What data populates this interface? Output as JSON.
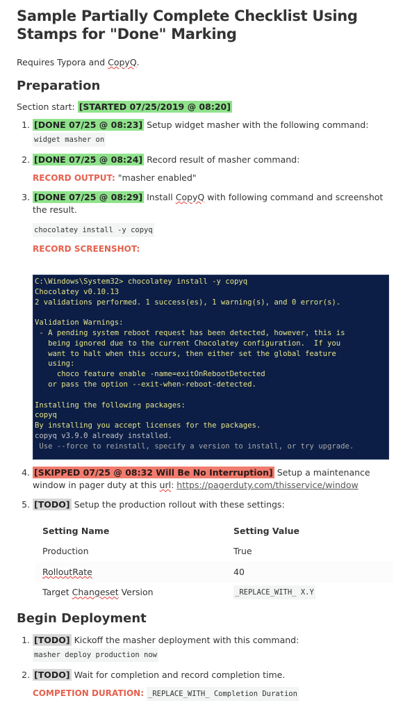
{
  "title": "Sample Partially Complete Checklist Using Stamps for \"Done\" Marking",
  "intro": {
    "before": "Requires Typora and ",
    "link": "CopyQ",
    "after": "."
  },
  "preparation": {
    "heading": "Preparation",
    "section_start_label": "Section start: ",
    "section_start_stamp": "[STARTED 07/25/2019 @ 08:20]",
    "items": [
      {
        "stamp": "[DONE 07/25 @ 08:23]",
        "text": " Setup widget masher with the following command:",
        "code": "widget masher on"
      },
      {
        "stamp": "[DONE 07/25 @ 08:24]",
        "text": " Record result of masher command:",
        "record_label": "RECORD OUTPUT:",
        "record_value": " \"masher enabled\""
      },
      {
        "stamp": "[DONE 07/25 @ 08:29]",
        "text_before": " Install ",
        "text_link": "CopyQ",
        "text_after": " with following command and screenshot the result.",
        "code": "chocolatey install -y copyq",
        "record_label": "RECORD SCREENSHOT:"
      },
      {
        "stamp": "[SKIPPED 07/25 @ 08:32 Will Be No Interruption]",
        "text_before": " Setup a maintenance window in pager duty at this ",
        "text_url_word": "url",
        "text_colon": ": ",
        "link": "https://pagerduty.com/thisservice/window"
      },
      {
        "stamp": "[TODO]",
        "text": " Setup the production rollout with these settings:"
      }
    ]
  },
  "terminal": {
    "lines": [
      {
        "text": "C:\\Windows\\System32> chocolatey install -y copyq",
        "color": "yellow"
      },
      {
        "text": "Chocolatey v0.10.13",
        "color": "yellow"
      },
      {
        "text": "2 validations performed. 1 success(es), 1 warning(s), and 0 error(s).",
        "color": "yellow"
      },
      {
        "text": "",
        "color": "gray"
      },
      {
        "text": "Validation Warnings:",
        "color": "yellow"
      },
      {
        "text": " - A pending system reboot request has been detected, however, this is",
        "color": "yellow"
      },
      {
        "text": "   being ignored due to the current Chocolatey configuration.  If you",
        "color": "yellow"
      },
      {
        "text": "   want to halt when this occurs, then either set the global feature",
        "color": "yellow"
      },
      {
        "text": "   using:",
        "color": "yellow"
      },
      {
        "text": "     choco feature enable -name=exitOnRebootDetected",
        "color": "yellow"
      },
      {
        "text": "   or pass the option --exit-when-reboot-detected.",
        "color": "yellow"
      },
      {
        "text": "",
        "color": "gray"
      },
      {
        "text": "Installing the following packages:",
        "color": "yellow"
      },
      {
        "text": "copyq",
        "color": "yellow"
      },
      {
        "text": "By installing you accept licenses for the packages.",
        "color": "yellow"
      },
      {
        "text": "copyq v3.9.0 already installed.",
        "color": "gray"
      },
      {
        "text": " Use --force to reinstall, specify a version to install, or try upgrade.",
        "color": "dim"
      }
    ]
  },
  "settings_table": {
    "headers": [
      "Setting Name",
      "Setting Value"
    ],
    "rows": [
      {
        "name": "Production",
        "value": "True"
      },
      {
        "name": "RolloutRate",
        "value": "40"
      },
      {
        "name_before": "Target ",
        "name_link": "Changeset",
        "name_after": " Version",
        "value": "_REPLACE_WITH_ X.Y"
      }
    ]
  },
  "deployment": {
    "heading": "Begin Deployment",
    "items": [
      {
        "stamp": "[TODO]",
        "text": " Kickoff the masher deployment with this command:",
        "code": "masher deploy production now"
      },
      {
        "stamp": "[TODO]",
        "text": " Wait for completion and record completion time.",
        "record_label": "COMPETION DURATION:",
        "code": "_REPLACE_WITH_ Completion Duration"
      }
    ]
  },
  "colors": {
    "stamp_done": "#8fe28b",
    "stamp_skipped": "#f17b6d",
    "stamp_todo": "#d7d7d7",
    "record_label": "#e5604d",
    "terminal_bg": "#0c1e45",
    "terminal_text": "#e6e38a"
  }
}
